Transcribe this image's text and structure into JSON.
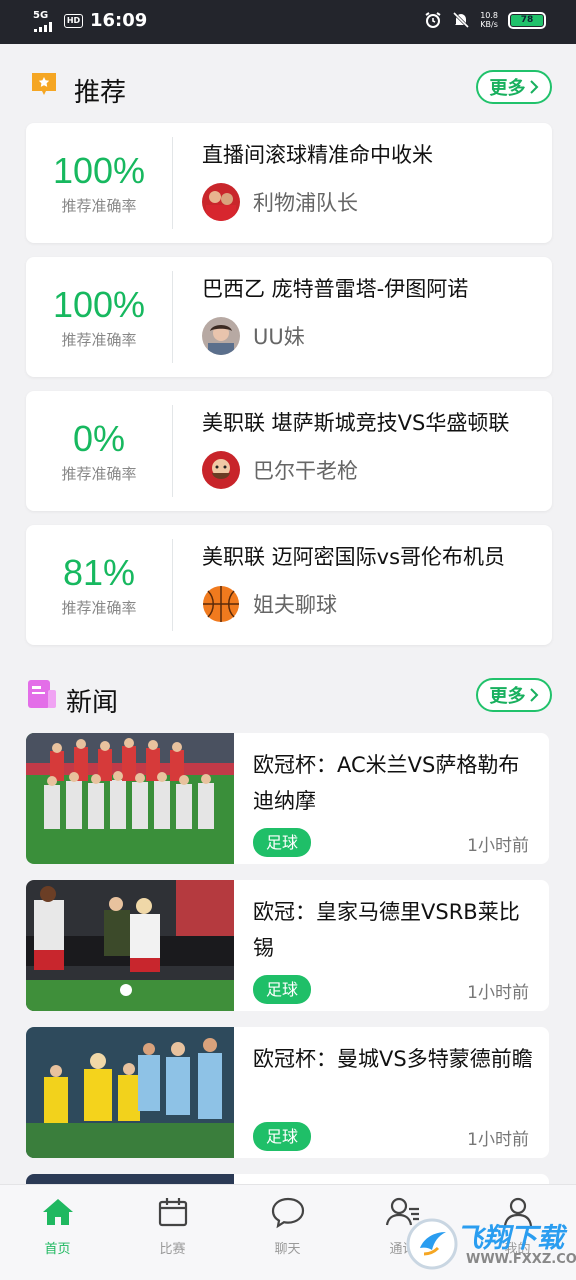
{
  "status_bar": {
    "network": "5G",
    "hd": "HD",
    "time": "16:09",
    "speed_value": "10.8",
    "speed_unit": "KB/s",
    "battery": "78"
  },
  "recommend": {
    "title": "推荐",
    "more": "更多",
    "items": [
      {
        "rate": "100%",
        "rate_label": "推荐准确率",
        "title": "直播间滚球精准命中收米",
        "author": "利物浦队长"
      },
      {
        "rate": "100%",
        "rate_label": "推荐准确率",
        "title": "巴西乙 庞特普雷塔-伊图阿诺",
        "author": "UU妹"
      },
      {
        "rate": "0%",
        "rate_label": "推荐准确率",
        "title": "美职联 堪萨斯城竞技VS华盛顿联",
        "author": "巴尔干老枪"
      },
      {
        "rate": "81%",
        "rate_label": "推荐准确率",
        "title": "美职联 迈阿密国际vs哥伦布机员",
        "author": "姐夫聊球"
      }
    ]
  },
  "news": {
    "title": "新闻",
    "more": "更多",
    "items": [
      {
        "title": "欧冠杯：AC米兰VS萨格勒布迪纳摩",
        "tag": "足球",
        "time": "1小时前"
      },
      {
        "title": "欧冠：皇家马德里VSRB莱比锡",
        "tag": "足球",
        "time": "1小时前"
      },
      {
        "title": "欧冠杯：曼城VS多特蒙德前瞻",
        "tag": "足球",
        "time": "1小时前"
      }
    ]
  },
  "bottom_nav": [
    {
      "label": "首页",
      "icon": "home-icon",
      "active": true
    },
    {
      "label": "比赛",
      "icon": "calendar-icon",
      "active": false
    },
    {
      "label": "聊天",
      "icon": "chat-bubble-icon",
      "active": false
    },
    {
      "label": "通讯",
      "icon": "contacts-icon",
      "active": false
    },
    {
      "label": "我的",
      "icon": "user-icon",
      "active": false
    }
  ],
  "watermark": {
    "text": "飞翔下载",
    "sub": "WWW.FXXZ.COM"
  },
  "colors": {
    "accent": "#1fbf68",
    "recommend_icon": "#f5a623",
    "news_icon": "#e36ee8"
  }
}
